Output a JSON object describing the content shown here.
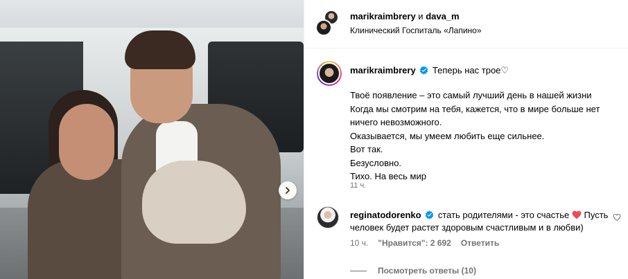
{
  "header": {
    "user1": "marikraimbrery",
    "conjunction": "и",
    "user2": "dava_m",
    "location": "Клинический Госпиталь «Лапино»"
  },
  "caption": {
    "username": "marikraimbrery",
    "headline": "Теперь нас трое♡",
    "lines": [
      "Твоё появление – это самый лучший день в нашей жизни",
      "Когда мы смотрим на тебя, кажется, что в мире больше нет",
      "ничего невозможного.",
      "Оказывается, мы умеем любить еще сильнее.",
      "Вот так.",
      "Безусловно.",
      "Тихо. На весь мир"
    ],
    "time": "11 ч."
  },
  "comment": {
    "username": "reginatodorenko",
    "text_before": "стать родителями - это счастье",
    "text_after": "Пусть человек будет растет здоровым счастливым и в любви)",
    "time": "10 ч.",
    "likes": "\"Нравится\": 2 692",
    "reply": "Ответить"
  },
  "view_replies": "Посмотреть ответы (10)",
  "colors": {
    "verified": "#0095f6",
    "heart": "#ed4956",
    "muted": "#737373"
  },
  "icons": {
    "next": "chevron-right-icon",
    "verified": "verified-badge-icon",
    "heart": "heart-icon"
  }
}
